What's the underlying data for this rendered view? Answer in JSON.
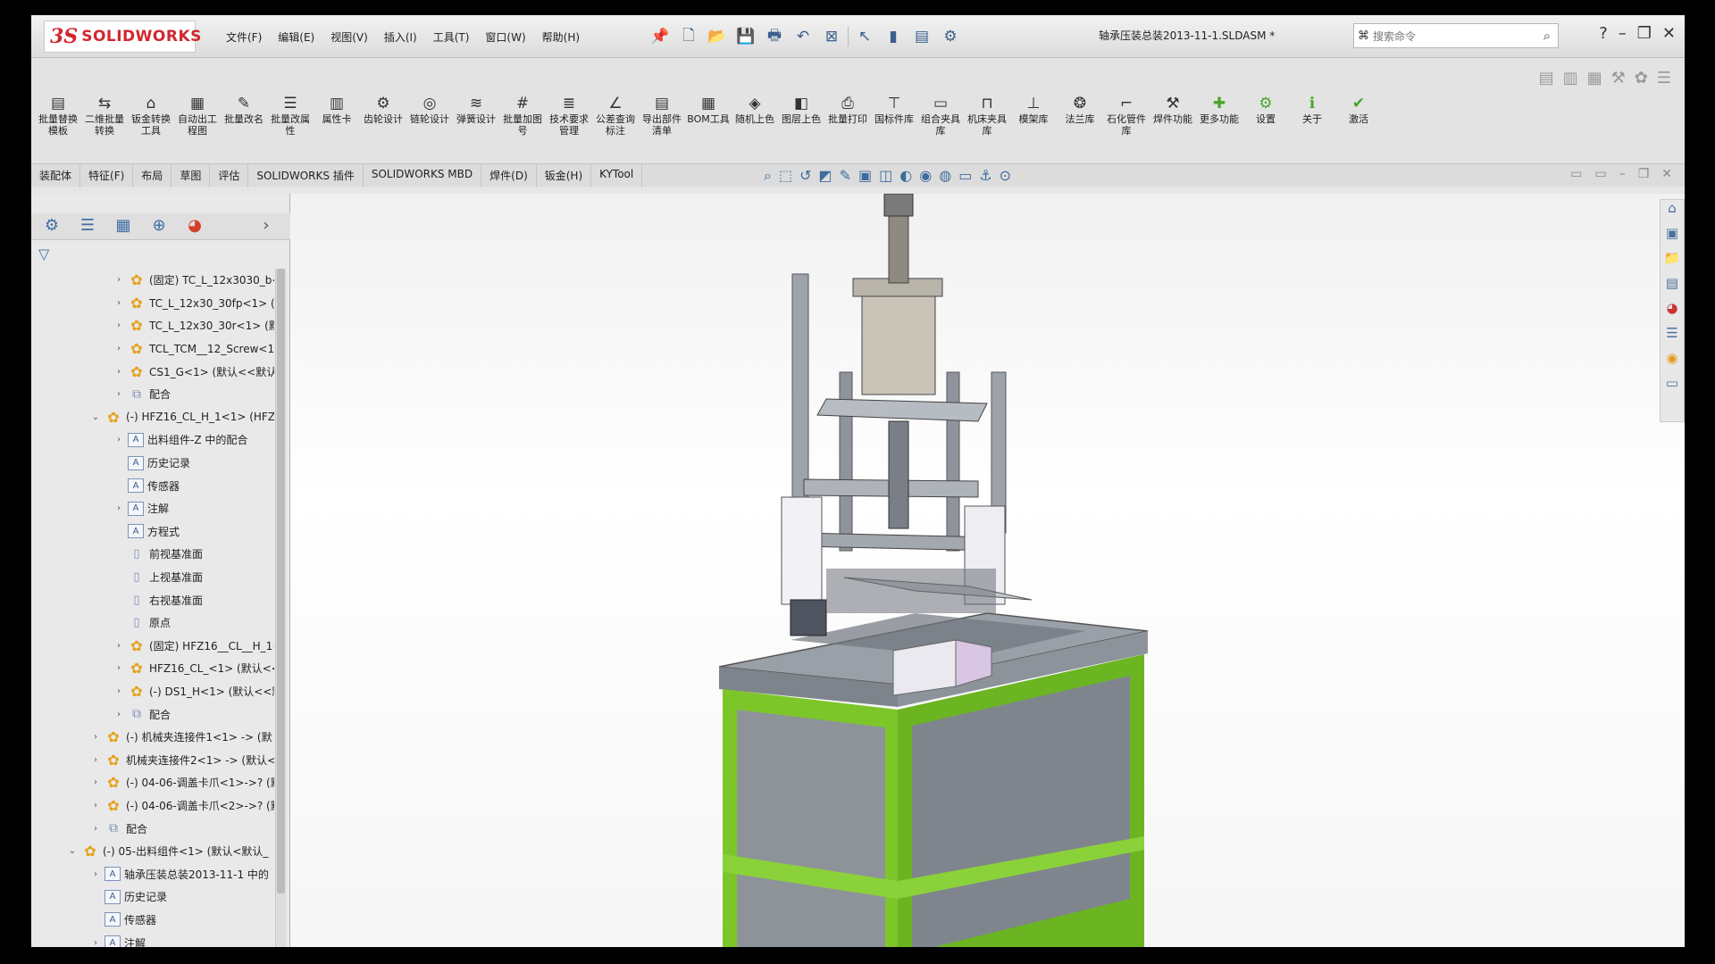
{
  "app": {
    "logo_prefix": "3S",
    "logo_name": "SOLIDWORKS",
    "document_title": "轴承压装总装2013-11-1.SLDASM *"
  },
  "menu": [
    "文件(F)",
    "编辑(E)",
    "视图(V)",
    "插入(I)",
    "工具(T)",
    "窗口(W)",
    "帮助(H)"
  ],
  "search": {
    "placeholder": "搜索命令"
  },
  "commands": [
    {
      "label": "批量替换模板",
      "icon": "replace-template-icon",
      "glyph": "▤"
    },
    {
      "label": "二维批量转换",
      "icon": "convert-2d-icon",
      "glyph": "⇆"
    },
    {
      "label": "钣金转换工具",
      "icon": "sheetmetal-icon",
      "glyph": "⌂"
    },
    {
      "label": "自动出工程图",
      "icon": "drawing-icon",
      "glyph": "▦"
    },
    {
      "label": "批量改名",
      "icon": "rename-icon",
      "glyph": "✎"
    },
    {
      "label": "批量改属性",
      "icon": "property-icon",
      "glyph": "☰"
    },
    {
      "label": "属性卡",
      "icon": "property-card-icon",
      "glyph": "▥"
    },
    {
      "label": "齿轮设计",
      "icon": "gear-design-icon",
      "glyph": "⚙"
    },
    {
      "label": "链轮设计",
      "icon": "sprocket-icon",
      "glyph": "◎"
    },
    {
      "label": "弹簧设计",
      "icon": "spring-icon",
      "glyph": "≋"
    },
    {
      "label": "批量加图号",
      "icon": "number-icon",
      "glyph": "#"
    },
    {
      "label": "技术要求管理",
      "icon": "tech-req-icon",
      "glyph": "≣"
    },
    {
      "label": "公差查询标注",
      "icon": "tolerance-icon",
      "glyph": "∠"
    },
    {
      "label": "导出部件清单",
      "icon": "export-list-icon",
      "glyph": "▤"
    },
    {
      "label": "BOM工具",
      "icon": "bom-icon",
      "glyph": "▦"
    },
    {
      "label": "随机上色",
      "icon": "random-color-icon",
      "glyph": "◈"
    },
    {
      "label": "图层上色",
      "icon": "layer-color-icon",
      "glyph": "◧"
    },
    {
      "label": "批量打印",
      "icon": "print-icon",
      "glyph": "⎙"
    },
    {
      "label": "国标件库",
      "icon": "gb-library-icon",
      "glyph": "⊤"
    },
    {
      "label": "组合夹具库",
      "icon": "fixture-icon",
      "glyph": "▭"
    },
    {
      "label": "机床夹具库",
      "icon": "machine-fixture-icon",
      "glyph": "⊓"
    },
    {
      "label": "模架库",
      "icon": "mold-base-icon",
      "glyph": "⊥"
    },
    {
      "label": "法兰库",
      "icon": "flange-icon",
      "glyph": "❂"
    },
    {
      "label": "石化管件库",
      "icon": "pipe-icon",
      "glyph": "⌐"
    },
    {
      "label": "焊件功能",
      "icon": "weld-icon",
      "glyph": "⚒"
    },
    {
      "label": "更多功能",
      "icon": "more-icon",
      "glyph": "✚",
      "green": true
    },
    {
      "label": "设置",
      "icon": "settings-icon",
      "glyph": "⚙",
      "green": true
    },
    {
      "label": "关于",
      "icon": "about-icon",
      "glyph": "ℹ",
      "green": true
    },
    {
      "label": "激活",
      "icon": "activate-icon",
      "glyph": "✔",
      "green": true
    }
  ],
  "tabs": [
    "装配体",
    "特征(F)",
    "布局",
    "草图",
    "评估",
    "SOLIDWORKS 插件",
    "SOLIDWORKS MBD",
    "焊件(D)",
    "钣金(H)",
    "KYTool"
  ],
  "tree": [
    {
      "indent": 2,
      "arrow": "›",
      "icon": "part",
      "text": "(固定) TC_L_12x3030_b<"
    },
    {
      "indent": 2,
      "arrow": "›",
      "icon": "part",
      "text": "TC_L_12x30_30fp<1> (默"
    },
    {
      "indent": 2,
      "arrow": "›",
      "icon": "part",
      "text": "TC_L_12x30_30r<1> (默认"
    },
    {
      "indent": 2,
      "arrow": "›",
      "icon": "part",
      "text": "TCL_TCM__12_Screw<1"
    },
    {
      "indent": 2,
      "arrow": "›",
      "icon": "part",
      "text": "CS1_G<1> (默认<<默认"
    },
    {
      "indent": 2,
      "arrow": "›",
      "icon": "mate",
      "text": "配合"
    },
    {
      "indent": 1,
      "arrow": "⌄",
      "icon": "asm",
      "text": "(-) HFZ16_CL_H_1<1> (HFZ1"
    },
    {
      "indent": 2,
      "arrow": "›",
      "icon": "feat",
      "text": "出料组件-Z 中的配合"
    },
    {
      "indent": 2,
      "arrow": "",
      "icon": "feat",
      "text": "历史记录"
    },
    {
      "indent": 2,
      "arrow": "",
      "icon": "feat",
      "text": "传感器"
    },
    {
      "indent": 2,
      "arrow": "›",
      "icon": "feat",
      "text": "注解"
    },
    {
      "indent": 2,
      "arrow": "",
      "icon": "feat",
      "text": "方程式"
    },
    {
      "indent": 2,
      "arrow": "",
      "icon": "plane",
      "text": "前视基准面"
    },
    {
      "indent": 2,
      "arrow": "",
      "icon": "plane",
      "text": "上视基准面"
    },
    {
      "indent": 2,
      "arrow": "",
      "icon": "plane",
      "text": "右视基准面"
    },
    {
      "indent": 2,
      "arrow": "",
      "icon": "plane",
      "text": "原点"
    },
    {
      "indent": 2,
      "arrow": "›",
      "icon": "part",
      "text": "(固定) HFZ16__CL__H_1<"
    },
    {
      "indent": 2,
      "arrow": "›",
      "icon": "part",
      "text": "HFZ16_CL_<1> (默认<<"
    },
    {
      "indent": 2,
      "arrow": "›",
      "icon": "part",
      "text": "(-) DS1_H<1> (默认<<默"
    },
    {
      "indent": 2,
      "arrow": "›",
      "icon": "mate",
      "text": "配合"
    },
    {
      "indent": 1,
      "arrow": "›",
      "icon": "part",
      "text": "(-) 机械夹连接件1<1> -> (默"
    },
    {
      "indent": 1,
      "arrow": "›",
      "icon": "part",
      "text": "机械夹连接件2<1> -> (默认<"
    },
    {
      "indent": 1,
      "arrow": "›",
      "icon": "part",
      "text": "(-) 04-06-调盖卡爪<1>->? (默"
    },
    {
      "indent": 1,
      "arrow": "›",
      "icon": "part",
      "text": "(-) 04-06-调盖卡爪<2>->? (默"
    },
    {
      "indent": 1,
      "arrow": "›",
      "icon": "mate",
      "text": "配合"
    },
    {
      "indent": 0,
      "arrow": "⌄",
      "icon": "asm",
      "text": "(-) 05-出料组件<1> (默认<默认_"
    },
    {
      "indent": 1,
      "arrow": "›",
      "icon": "feat",
      "text": "轴承压装总装2013-11-1 中的"
    },
    {
      "indent": 1,
      "arrow": "",
      "icon": "feat",
      "text": "历史记录"
    },
    {
      "indent": 1,
      "arrow": "",
      "icon": "feat",
      "text": "传感器"
    },
    {
      "indent": 1,
      "arrow": "›",
      "icon": "feat",
      "text": "注解"
    }
  ]
}
